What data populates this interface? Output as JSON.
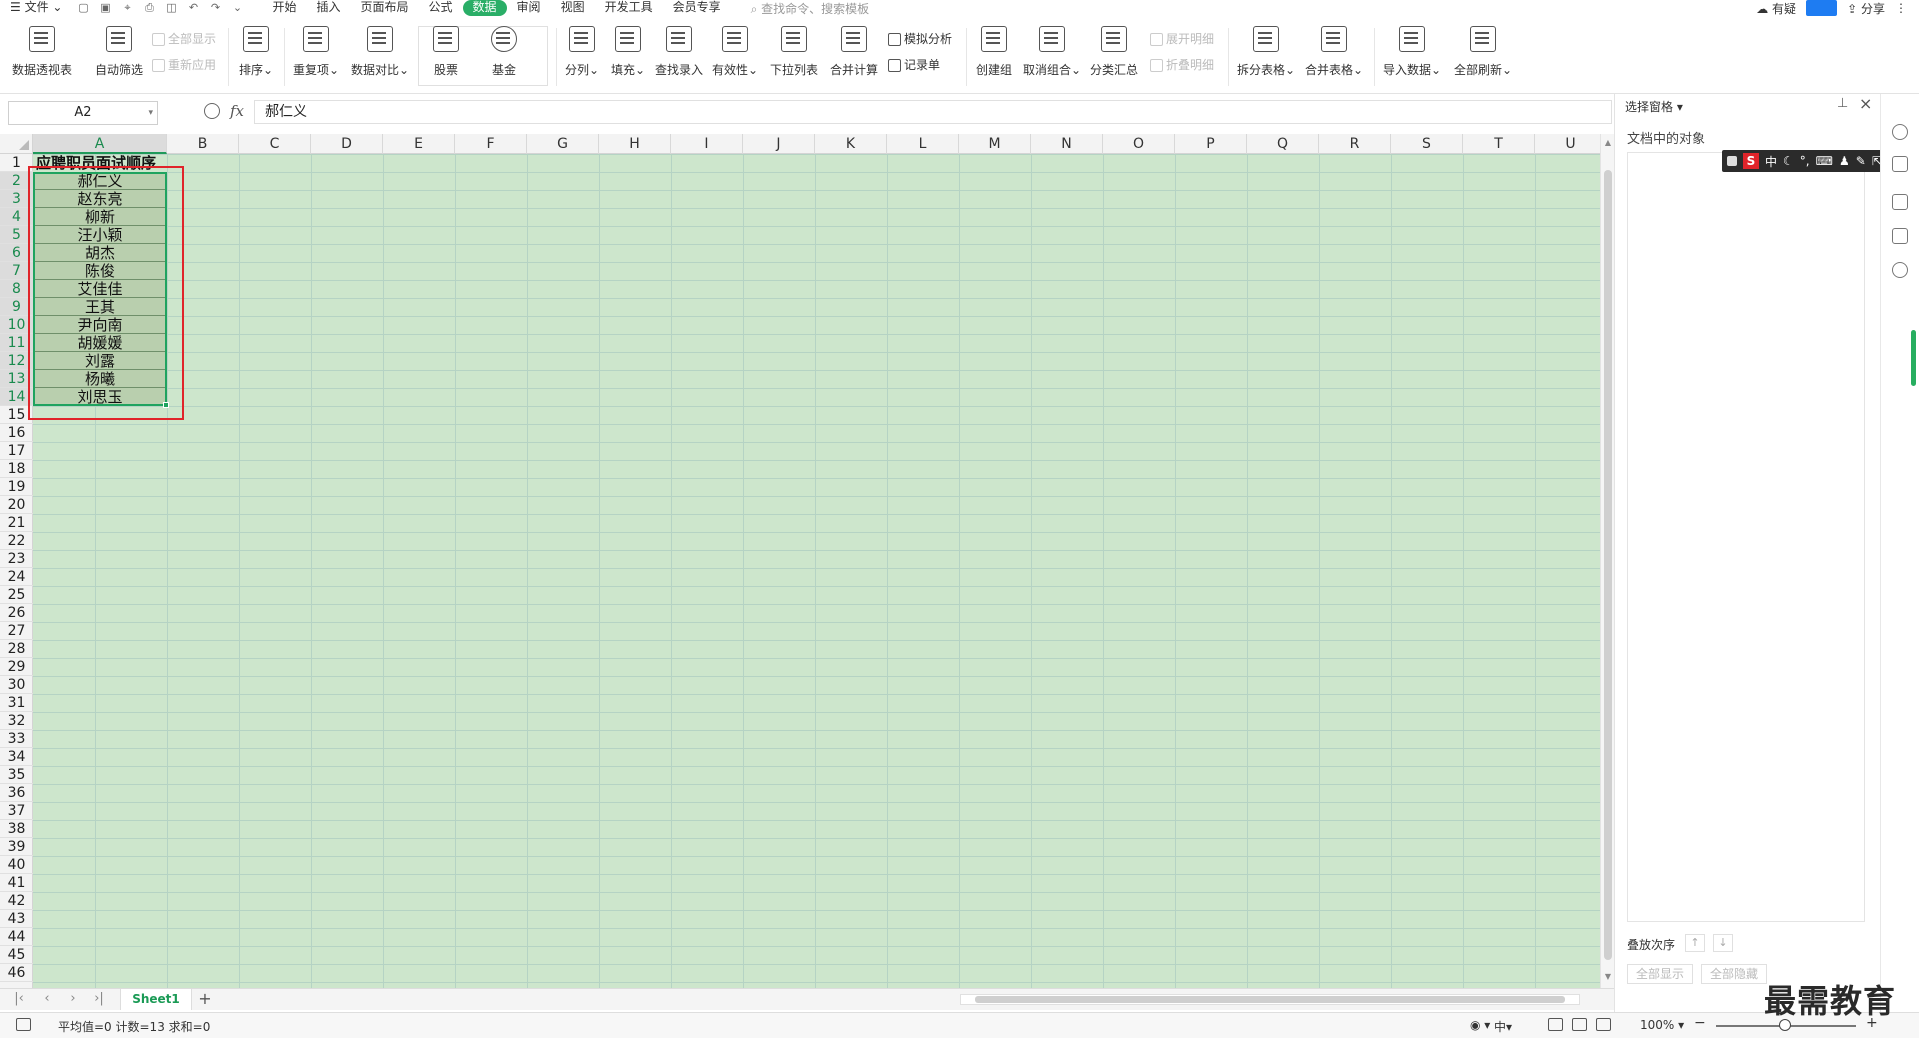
{
  "menu": {
    "file": "文件",
    "tabs": [
      "开始",
      "插入",
      "页面布局",
      "公式",
      "数据",
      "审阅",
      "视图",
      "开发工具",
      "会员专享"
    ],
    "active_tab": "数据",
    "search_placeholder": "查找命令、搜索模板",
    "right_items": [
      "有疑",
      "分享"
    ]
  },
  "ribbon": {
    "pivot": "数据透视表",
    "autofilter": "自动筛选",
    "show_all": "全部显示",
    "reapply": "重新应用",
    "sort": "排序",
    "duplicates": "重复项",
    "compare": "数据对比",
    "stock": "股票",
    "fund": "基金",
    "split_col": "分列",
    "fill": "填充",
    "lookup_entry": "查找录入",
    "validity": "有效性",
    "dropdown_list": "下拉列表",
    "consolidate": "合并计算",
    "whatif": "模拟分析",
    "record": "记录单",
    "group": "创建组",
    "ungroup": "取消组合",
    "subtotal": "分类汇总",
    "expand_detail": "展开明细",
    "collapse_detail": "折叠明细",
    "split_table": "拆分表格",
    "merge_table": "合并表格",
    "import_data": "导入数据",
    "refresh_all": "全部刷新"
  },
  "formula_bar": {
    "name_box": "A2",
    "fx": "fx",
    "content": "郝仁义"
  },
  "grid": {
    "columns": [
      "A",
      "B",
      "C",
      "D",
      "E",
      "F",
      "G",
      "H",
      "I",
      "J",
      "K",
      "L",
      "M",
      "N",
      "O",
      "P",
      "Q",
      "R",
      "S",
      "T",
      "U"
    ],
    "rows": [
      "1",
      "2",
      "3",
      "4",
      "5",
      "6",
      "7",
      "8",
      "9",
      "10",
      "11",
      "12",
      "13",
      "14",
      "15",
      "16",
      "17",
      "18",
      "19",
      "20",
      "21",
      "22",
      "23",
      "24",
      "25",
      "26",
      "27",
      "28",
      "29",
      "30",
      "31",
      "32",
      "33",
      "34",
      "35",
      "36",
      "37",
      "38",
      "39",
      "40",
      "41",
      "42",
      "43",
      "44",
      "45",
      "46"
    ],
    "title": "应聘职员面试顺序",
    "names": [
      "郝仁义",
      "赵东亮",
      "柳新",
      "汪小颖",
      "胡杰",
      "陈俊",
      "艾佳佳",
      "王其",
      "尹向南",
      "胡媛媛",
      "刘露",
      "杨曦",
      "刘思玉"
    ]
  },
  "sheets": {
    "active": "Sheet1"
  },
  "pane": {
    "title": "选择窗格",
    "subtitle": "文档中的对象",
    "order_label": "叠放次序",
    "show_all": "全部显示",
    "hide_all": "全部隐藏"
  },
  "ime": {
    "lang": "中"
  },
  "status": {
    "summary": "平均值=0  计数=13  求和=0",
    "zoom": "100%"
  },
  "watermark": "最需教育"
}
